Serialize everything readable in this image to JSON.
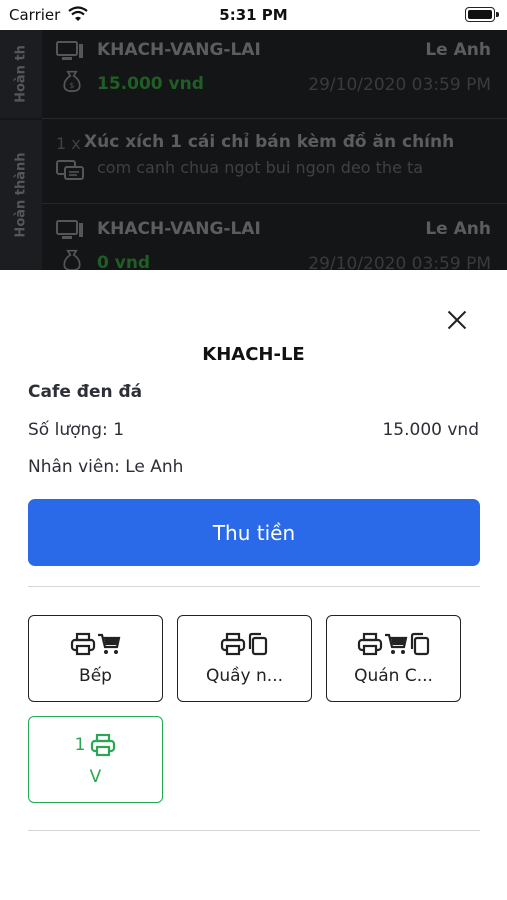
{
  "status": {
    "carrier": "Carrier",
    "time": "5:31 PM"
  },
  "background": {
    "order1": {
      "side_tag": "Hoàn th",
      "customer": "KHACH-VANG-LAI",
      "staff": "Le Anh",
      "amount": "15.000 vnd",
      "datetime": "29/10/2020 03:59 PM"
    },
    "item": {
      "qty": "1 x",
      "name": "Xúc xích 1 cái chỉ bán kèm đồ ăn chính",
      "note": "com canh chua ngot bui ngon deo the ta"
    },
    "order2": {
      "side_tag": "Hoàn thành",
      "customer": "KHACH-VANG-LAI",
      "staff": "Le Anh",
      "amount": "0 vnd",
      "datetime": "29/10/2020 03:59 PM"
    }
  },
  "sheet": {
    "title": "KHACH-LE",
    "product": "Cafe đen đá",
    "quantity": "Số lượng: 1",
    "price": "15.000 vnd",
    "staff": "Nhân viên: Le Anh",
    "pay_label": "Thu tiền",
    "printers": [
      {
        "label": "Bếp",
        "icons": [
          "printer-icon",
          "cart-icon"
        ]
      },
      {
        "label": "Quầy n...",
        "icons": [
          "printer-icon",
          "copy-icon"
        ]
      },
      {
        "label": "Quán C...",
        "icons": [
          "printer-icon",
          "cart-icon",
          "copy-icon"
        ]
      }
    ],
    "selected_printer": {
      "count": "1",
      "label": "V",
      "icon": "printer-icon"
    }
  },
  "colors": {
    "accent": "#2a6ae8",
    "success": "#2aa655",
    "overlay": "#141517"
  }
}
